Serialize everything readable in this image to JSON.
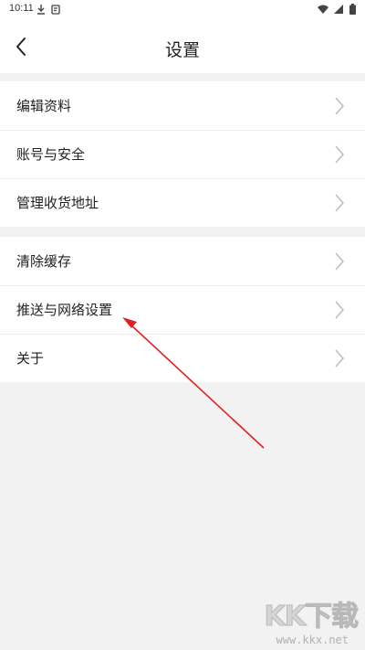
{
  "status_bar": {
    "time": "10:11",
    "left_icons": [
      "download-icon",
      "notification-icon"
    ],
    "right_icons": [
      "wifi-icon",
      "signal-icon",
      "battery-icon"
    ]
  },
  "header": {
    "title": "设置",
    "back_icon": "chevron-left-icon"
  },
  "groups": [
    {
      "items": [
        {
          "label": "编辑资料"
        },
        {
          "label": "账号与安全"
        },
        {
          "label": "管理收货地址"
        }
      ]
    },
    {
      "items": [
        {
          "label": "清除缓存"
        },
        {
          "label": "推送与网络设置"
        },
        {
          "label": "关于"
        }
      ]
    }
  ],
  "annotation": {
    "color": "#e02020",
    "points_to": "推送与网络设置"
  },
  "watermark": {
    "logo": "KK下载",
    "url": "www.kkx.net"
  },
  "colors": {
    "background": "#f2f2f2",
    "surface": "#ffffff",
    "divider": "#ececec",
    "chevron": "#bbbbbb"
  }
}
